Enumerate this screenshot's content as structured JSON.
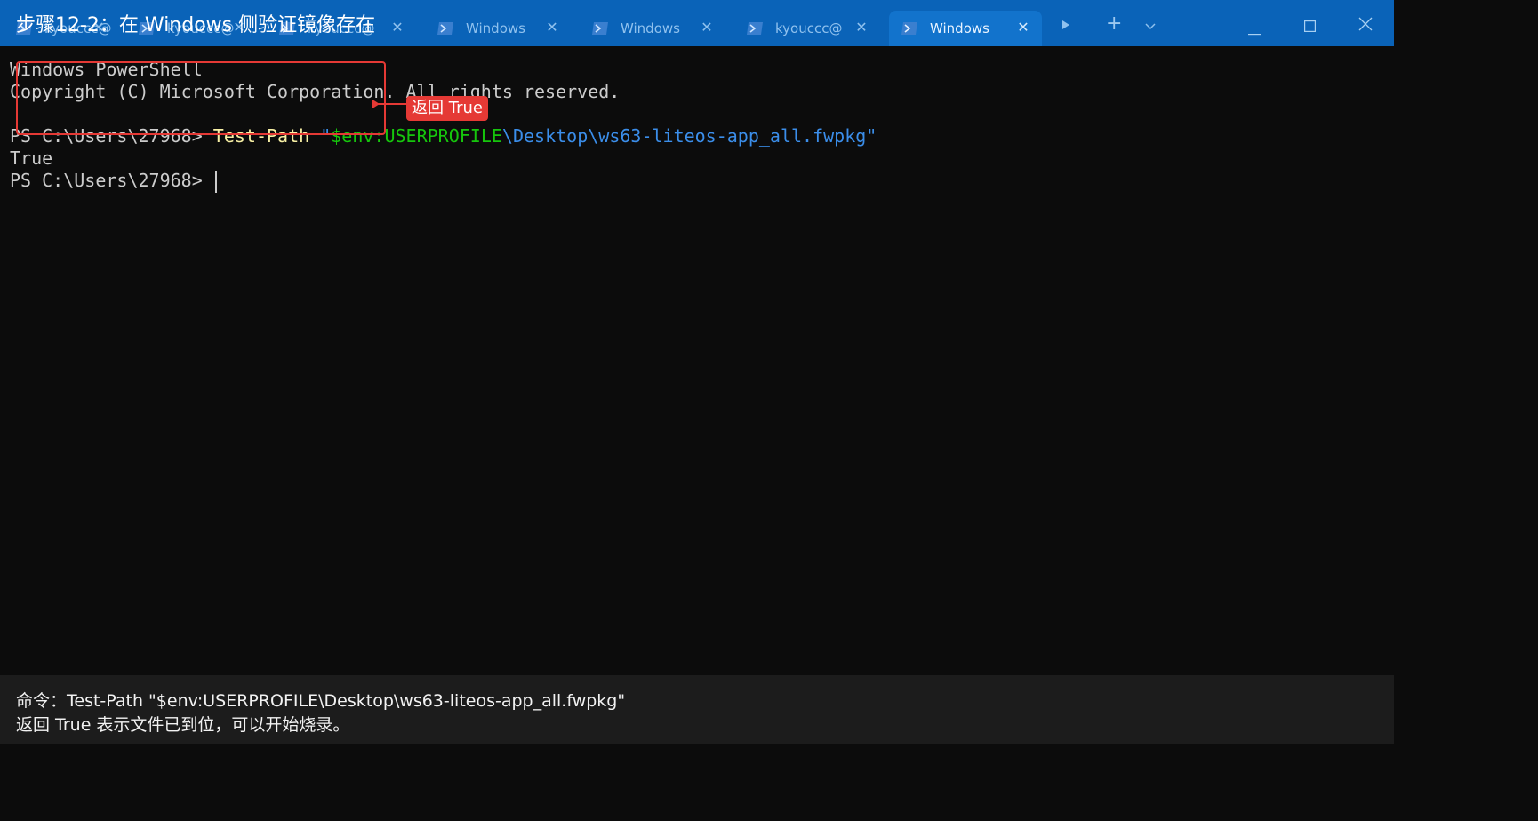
{
  "step_title": "步骤12-2：在 Windows 侧验证镜像存在",
  "tabs": [
    {
      "label": "kyouccc@",
      "active": false
    },
    {
      "label": "kyouccc@",
      "active": false
    },
    {
      "label": "kyouccc@",
      "active": false
    },
    {
      "label": "Windows",
      "active": false
    },
    {
      "label": "kyouccc@",
      "active": false
    },
    {
      "label": "Windows",
      "active": true
    }
  ],
  "icons": {
    "tab": "powershell-icon",
    "close": "close-icon",
    "run": "play-icon",
    "new_tab": "plus-icon",
    "dropdown": "chevron-down-icon",
    "minimize": "minimize-icon",
    "maximize": "maximize-icon",
    "window_close": "close-icon"
  },
  "terminal": {
    "line1": "Windows PowerShell",
    "line2": "Copyright (C) Microsoft Corporation. All rights reserved.",
    "prompt": "PS C:\\Users\\27968> ",
    "cmd_name": "Test-Path",
    "arg_quote_open": "\"",
    "arg_var": "$env:USERPROFILE",
    "arg_path": "\\Desktop\\ws63-liteos-app_all.fwpkg\"",
    "output": "True",
    "prompt2": "PS C:\\Users\\27968> "
  },
  "annotation": {
    "label": "返回 True",
    "color": "#e53935"
  },
  "caption": {
    "line1": "命令：Test-Path \"$env:USERPROFILE\\Desktop\\ws63-liteos-app_all.fwpkg\"",
    "line2": "返回 True 表示文件已到位，可以开始烧录。"
  },
  "colors": {
    "titlebar": "#0a63b8",
    "active_tab": "#1273cc",
    "terminal_bg": "#0c0c0c",
    "cmd": "#f9f1a5",
    "string": "#3b8eea",
    "variable": "#16c60c"
  }
}
